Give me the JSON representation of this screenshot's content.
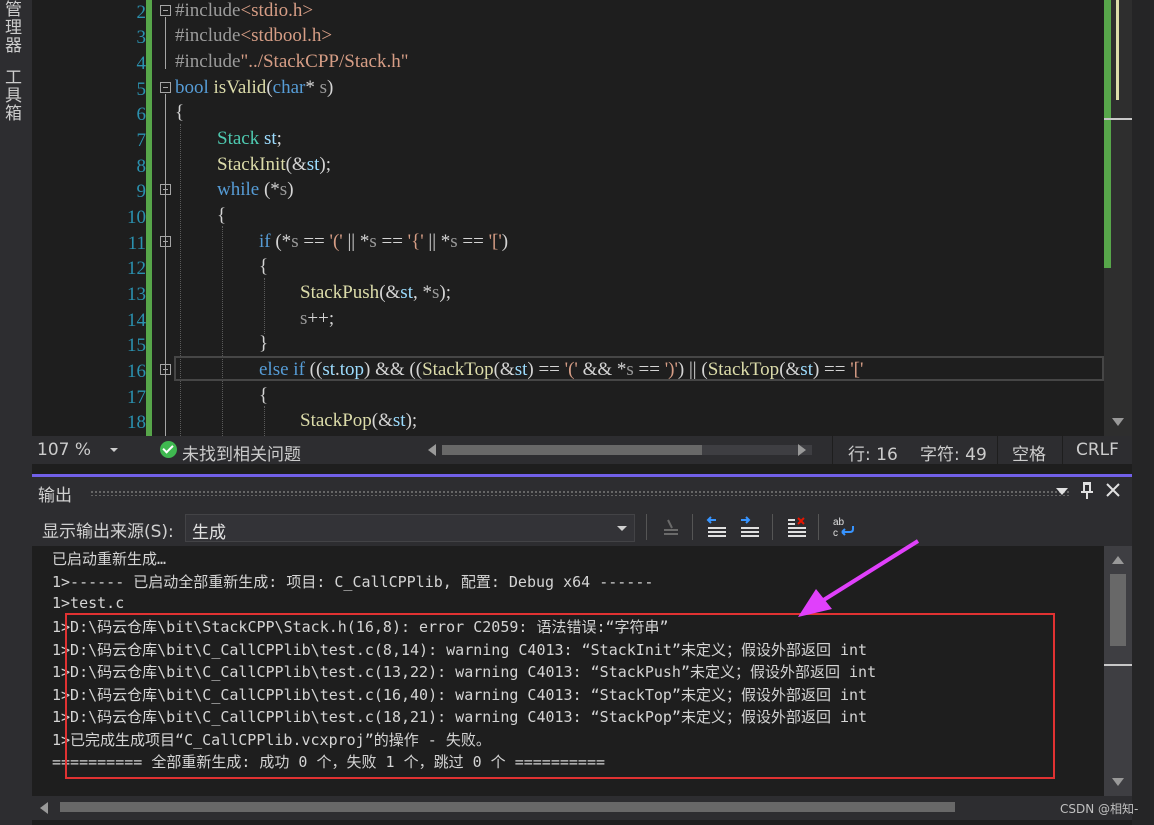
{
  "left_strip": {
    "item1": "管理器",
    "item2": "工具箱"
  },
  "editor": {
    "line_numbers": [
      "2",
      "3",
      "4",
      "5",
      "6",
      "7",
      "8",
      "9",
      "10",
      "11",
      "12",
      "13",
      "14",
      "15",
      "16",
      "17",
      "18"
    ]
  },
  "status_bar": {
    "zoom": "107 %",
    "issues": "未找到相关问题",
    "line": "行: 16",
    "char": "字符: 49",
    "whitespace": "空格",
    "line_ending": "CRLF"
  },
  "output": {
    "title": "输出",
    "source_label": "显示输出来源(S):",
    "source_value": "生成",
    "lines": [
      "已启动重新生成…",
      "1>------ 已启动全部重新生成: 项目: C_CallCPPlib, 配置: Debug x64 ------",
      "1>test.c",
      "1>D:\\码云仓库\\bit\\StackCPP\\Stack.h(16,8): error C2059: 语法错误:“字符串”",
      "1>D:\\码云仓库\\bit\\C_CallCPPlib\\test.c(8,14): warning C4013: “StackInit”未定义；假设外部返回 int",
      "1>D:\\码云仓库\\bit\\C_CallCPPlib\\test.c(13,22): warning C4013: “StackPush”未定义；假设外部返回 int",
      "1>D:\\码云仓库\\bit\\C_CallCPPlib\\test.c(16,40): warning C4013: “StackTop”未定义；假设外部返回 int",
      "1>D:\\码云仓库\\bit\\C_CallCPPlib\\test.c(18,21): warning C4013: “StackPop”未定义；假设外部返回 int",
      "1>已完成生成项目“C_CallCPPlib.vcxproj”的操作 - 失败。",
      "========== 全部重新生成: 成功 0 个，失败 1 个，跳过 0 个 =========="
    ]
  },
  "watermark": "CSDN @相知-",
  "colors": {
    "accent": "#7160e8",
    "highlight_box": "#e03232",
    "arrow": "#e040fb",
    "change_bar": "#57a64a"
  }
}
